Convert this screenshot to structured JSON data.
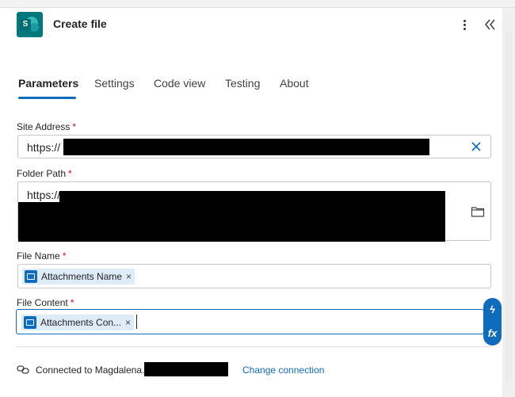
{
  "header": {
    "title": "Create file",
    "app_icon_letter": "S",
    "icons": {
      "app": "sharepoint-icon",
      "more": "more-vertical-icon",
      "collapse": "collapse-double-chevron-icon"
    }
  },
  "tabs": [
    {
      "label": "Parameters",
      "active": true
    },
    {
      "label": "Settings",
      "active": false
    },
    {
      "label": "Code view",
      "active": false
    },
    {
      "label": "Testing",
      "active": false
    },
    {
      "label": "About",
      "active": false
    }
  ],
  "fields": {
    "site_address": {
      "label": "Site Address",
      "required": "*",
      "value": "https://"
    },
    "folder_path": {
      "label": "Folder Path",
      "required": "*",
      "value": "https://"
    },
    "file_name": {
      "label": "File Name",
      "required": "*",
      "token": "Attachments Name",
      "token_remove": "×"
    },
    "file_content": {
      "label": "File Content",
      "required": "*",
      "token": "Attachments Con...",
      "token_remove": "×"
    }
  },
  "side_buttons": {
    "dynamic_content": "ϟ",
    "expression": "fx"
  },
  "connection": {
    "text": "Connected to Magdalena.",
    "link": "Change connection"
  },
  "colors": {
    "accent": "#0f6cbd",
    "required": "#c50f1f",
    "sharepoint": "#03787c",
    "token_bg": "#deecf9"
  }
}
